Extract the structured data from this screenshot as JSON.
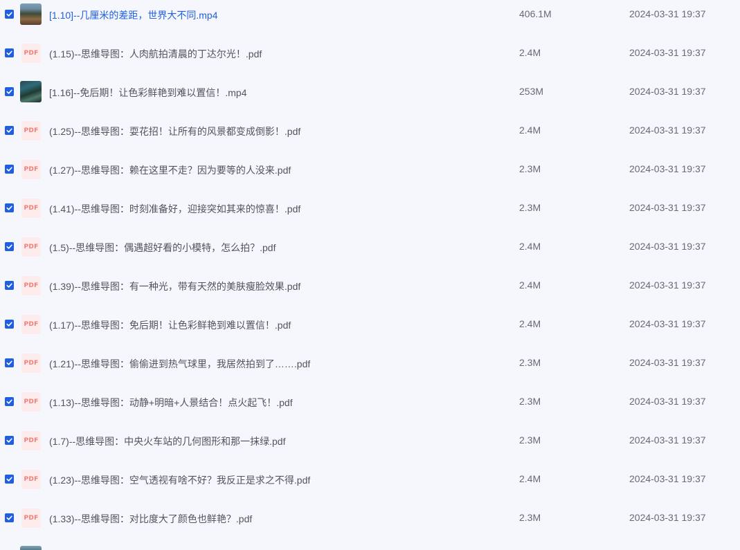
{
  "files": [
    {
      "name": "[1.10]--几厘米的差距，世界大不同.mp4",
      "size": "406.1M",
      "date": "2024-03-31 19:37",
      "type": "video",
      "thumb": "video1",
      "checked": true,
      "highlighted": true
    },
    {
      "name": "(1.15)--思维导图：人肉航拍清晨的丁达尔光！.pdf",
      "size": "2.4M",
      "date": "2024-03-31 19:37",
      "type": "pdf",
      "thumb": "pdf",
      "checked": true,
      "highlighted": false
    },
    {
      "name": "[1.16]--免后期！让色彩鲜艳到难以置信！.mp4",
      "size": "253M",
      "date": "2024-03-31 19:37",
      "type": "video",
      "thumb": "video2",
      "checked": true,
      "highlighted": false
    },
    {
      "name": "(1.25)--思维导图：耍花招！让所有的风景都变成倒影！.pdf",
      "size": "2.4M",
      "date": "2024-03-31 19:37",
      "type": "pdf",
      "thumb": "pdf",
      "checked": true,
      "highlighted": false
    },
    {
      "name": "(1.27)--思维导图：赖在这里不走？因为要等的人没来.pdf",
      "size": "2.3M",
      "date": "2024-03-31 19:37",
      "type": "pdf",
      "thumb": "pdf",
      "checked": true,
      "highlighted": false
    },
    {
      "name": "(1.41)--思维导图：时刻准备好，迎接突如其来的惊喜！.pdf",
      "size": "2.3M",
      "date": "2024-03-31 19:37",
      "type": "pdf",
      "thumb": "pdf",
      "checked": true,
      "highlighted": false
    },
    {
      "name": "(1.5)--思维导图：偶遇超好看的小模特，怎么拍？.pdf",
      "size": "2.4M",
      "date": "2024-03-31 19:37",
      "type": "pdf",
      "thumb": "pdf",
      "checked": true,
      "highlighted": false
    },
    {
      "name": "(1.39)--思维导图：有一种光，带有天然的美肤瘦脸效果.pdf",
      "size": "2.4M",
      "date": "2024-03-31 19:37",
      "type": "pdf",
      "thumb": "pdf",
      "checked": true,
      "highlighted": false
    },
    {
      "name": "(1.17)--思维导图：免后期！让色彩鲜艳到难以置信！.pdf",
      "size": "2.4M",
      "date": "2024-03-31 19:37",
      "type": "pdf",
      "thumb": "pdf",
      "checked": true,
      "highlighted": false
    },
    {
      "name": "(1.21)--思维导图：偷偷进到热气球里，我居然拍到了…….pdf",
      "size": "2.3M",
      "date": "2024-03-31 19:37",
      "type": "pdf",
      "thumb": "pdf",
      "checked": true,
      "highlighted": false
    },
    {
      "name": "(1.13)--思维导图：动静+明暗+人景结合！点火起飞！.pdf",
      "size": "2.3M",
      "date": "2024-03-31 19:37",
      "type": "pdf",
      "thumb": "pdf",
      "checked": true,
      "highlighted": false
    },
    {
      "name": "(1.7)--思维导图：中央火车站的几何图形和那一抹绿.pdf",
      "size": "2.3M",
      "date": "2024-03-31 19:37",
      "type": "pdf",
      "thumb": "pdf",
      "checked": true,
      "highlighted": false
    },
    {
      "name": "(1.23)--思维导图：空气透视有啥不好？我反正是求之不得.pdf",
      "size": "2.4M",
      "date": "2024-03-31 19:37",
      "type": "pdf",
      "thumb": "pdf",
      "checked": true,
      "highlighted": false
    },
    {
      "name": "(1.33)--思维导图：对比度大了颜色也鲜艳？.pdf",
      "size": "2.3M",
      "date": "2024-03-31 19:37",
      "type": "pdf",
      "thumb": "pdf",
      "checked": true,
      "highlighted": false
    }
  ],
  "pdf_badge": "PDF",
  "colors": {
    "accent": "#1f5fe0",
    "background": "#f6f7fd",
    "text": "#50545c",
    "pdf_badge_bg": "#fdeceb",
    "pdf_badge_text": "#f0807a"
  },
  "icons": {
    "checkbox": "check-icon",
    "pdf": "pdf-file-icon",
    "video": "video-thumbnail"
  }
}
